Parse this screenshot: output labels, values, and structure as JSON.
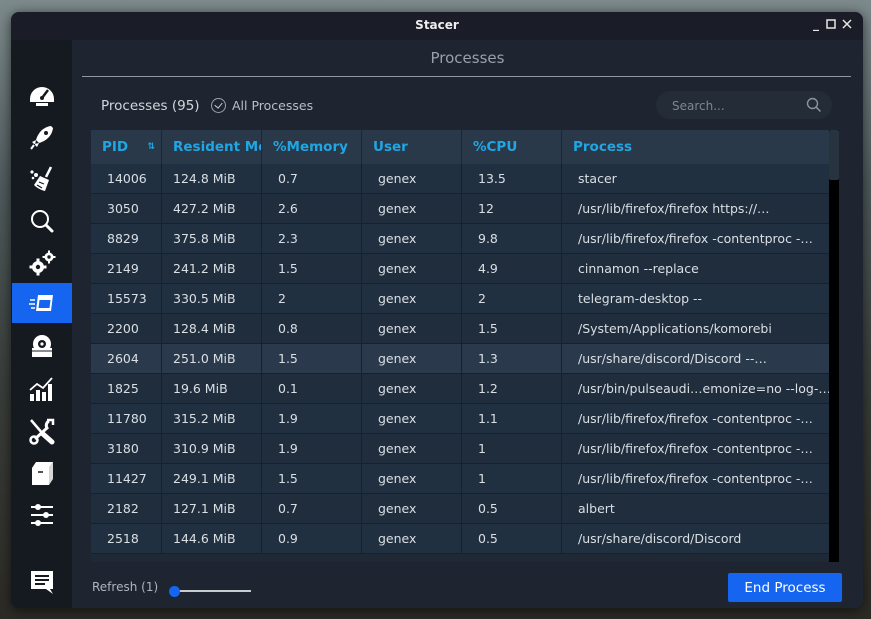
{
  "window": {
    "title": "Stacer",
    "controls": {
      "minimize": "_",
      "maximize": "☐",
      "close": "✕"
    }
  },
  "sidebar": {
    "items": [
      {
        "id": "dashboard",
        "icon": "speedometer-icon",
        "active": false
      },
      {
        "id": "startup-apps",
        "icon": "rocket-icon",
        "active": false
      },
      {
        "id": "system-cleaner",
        "icon": "broom-icon",
        "active": false
      },
      {
        "id": "search",
        "icon": "magnifier-icon",
        "active": false
      },
      {
        "id": "services",
        "icon": "gears-icon",
        "active": false
      },
      {
        "id": "processes",
        "icon": "processes-window-icon",
        "active": true
      },
      {
        "id": "uninstaller",
        "icon": "disk-box-icon",
        "active": false
      },
      {
        "id": "resources",
        "icon": "bar-chart-icon",
        "active": false
      },
      {
        "id": "helpers",
        "icon": "tools-icon",
        "active": false
      },
      {
        "id": "apt-repository",
        "icon": "package-icon",
        "active": false
      },
      {
        "id": "settings",
        "icon": "sliders-icon",
        "active": false
      },
      {
        "id": "feedback",
        "icon": "chat-icon",
        "active": false
      }
    ]
  },
  "colors": {
    "accent": "#1665f0",
    "header_text": "#1ea7e4"
  },
  "main": {
    "page_title": "Processes",
    "process_count_label": "Processes (95)",
    "all_processes_label": "All Processes",
    "all_processes_checked": true,
    "search": {
      "placeholder": "Search...",
      "value": ""
    },
    "table": {
      "columns": [
        "PID",
        "Resident Me",
        "%Memory",
        "User",
        "%CPU",
        "Process"
      ],
      "sort_column": "PID",
      "rows": [
        [
          "14006",
          "124.8 MiB",
          "0.7",
          "genex",
          "13.5",
          "stacer"
        ],
        [
          "3050",
          "427.2 MiB",
          "2.6",
          "genex",
          "12",
          "/usr/lib/firefox/firefox https://…"
        ],
        [
          "8829",
          "375.8 MiB",
          "2.3",
          "genex",
          "9.8",
          "/usr/lib/firefox/firefox -contentproc -…"
        ],
        [
          "2149",
          "241.2 MiB",
          "1.5",
          "genex",
          "4.9",
          "cinnamon --replace"
        ],
        [
          "15573",
          "330.5 MiB",
          "2",
          "genex",
          "2",
          "telegram-desktop --"
        ],
        [
          "2200",
          "128.4 MiB",
          "0.8",
          "genex",
          "1.5",
          "/System/Applications/komorebi"
        ],
        [
          "2604",
          "251.0 MiB",
          "1.5",
          "genex",
          "1.3",
          "/usr/share/discord/Discord --…"
        ],
        [
          "1825",
          "19.6 MiB",
          "0.1",
          "genex",
          "1.2",
          "/usr/bin/pulseaudi…emonize=no --log-…"
        ],
        [
          "11780",
          "315.2 MiB",
          "1.9",
          "genex",
          "1.1",
          "/usr/lib/firefox/firefox -contentproc -…"
        ],
        [
          "3180",
          "310.9 MiB",
          "1.9",
          "genex",
          "1",
          "/usr/lib/firefox/firefox -contentproc -…"
        ],
        [
          "11427",
          "249.1 MiB",
          "1.5",
          "genex",
          "1",
          "/usr/lib/firefox/firefox -contentproc -…"
        ],
        [
          "2182",
          "127.1 MiB",
          "0.7",
          "genex",
          "0.5",
          "albert"
        ],
        [
          "2518",
          "144.6 MiB",
          "0.9",
          "genex",
          "0.5",
          "/usr/share/discord/Discord"
        ]
      ],
      "highlighted_row": 6
    },
    "footer": {
      "refresh_label": "Refresh (1)",
      "refresh_value": 1,
      "end_process_label": "End Process"
    }
  }
}
